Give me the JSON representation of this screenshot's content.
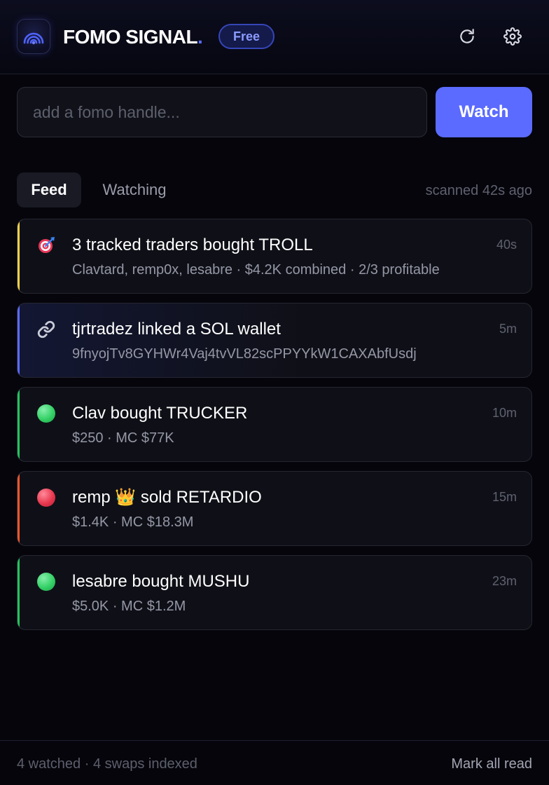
{
  "app": {
    "brand": "FOMO SIGNAL",
    "brand_dot": ".",
    "plan": "Free",
    "icons": {
      "logo": "signal-icon",
      "refresh": "refresh-icon",
      "settings": "gear-icon"
    }
  },
  "search": {
    "value": "",
    "placeholder": "add a fomo handle...",
    "button_label": "Watch"
  },
  "tabs": {
    "items": [
      {
        "label": "Feed",
        "active": true
      },
      {
        "label": "Watching",
        "active": false
      }
    ],
    "status": "scanned 42s ago"
  },
  "feed": {
    "items": [
      {
        "icon": "target-icon",
        "title": "3 tracked traders bought TROLL",
        "subtitle": "Clavtard, remp0x, lesabre · $4.2K combined · 2/3 profitable",
        "time": "40s",
        "accent": "#f5d24a"
      },
      {
        "icon": "link-icon",
        "title": "tjrtradez linked a SOL wallet",
        "subtitle": "9fnyojTv8GYHWr4Vaj4tvVL82scPPYYkW1CAXAbfUsdj",
        "time": "5m",
        "accent": "#5b6bff"
      },
      {
        "icon": "green-circle-icon",
        "title": "Clav bought TRUCKER",
        "subtitle": "$250 · MC $77K",
        "time": "10m",
        "accent": "#22c55e"
      },
      {
        "icon": "red-circle-icon",
        "title": "remp 👑 sold RETARDIO",
        "subtitle": "$1.4K · MC $18.3M",
        "time": "15m",
        "accent": "#f0562a"
      },
      {
        "icon": "green-circle-icon",
        "title": "lesabre bought MUSHU",
        "subtitle": "$5.0K · MC $1.2M",
        "time": "23m",
        "accent": "#22c55e"
      }
    ]
  },
  "footer": {
    "stats": "4 watched · 4 swaps indexed",
    "mark_all_read": "Mark all read"
  }
}
